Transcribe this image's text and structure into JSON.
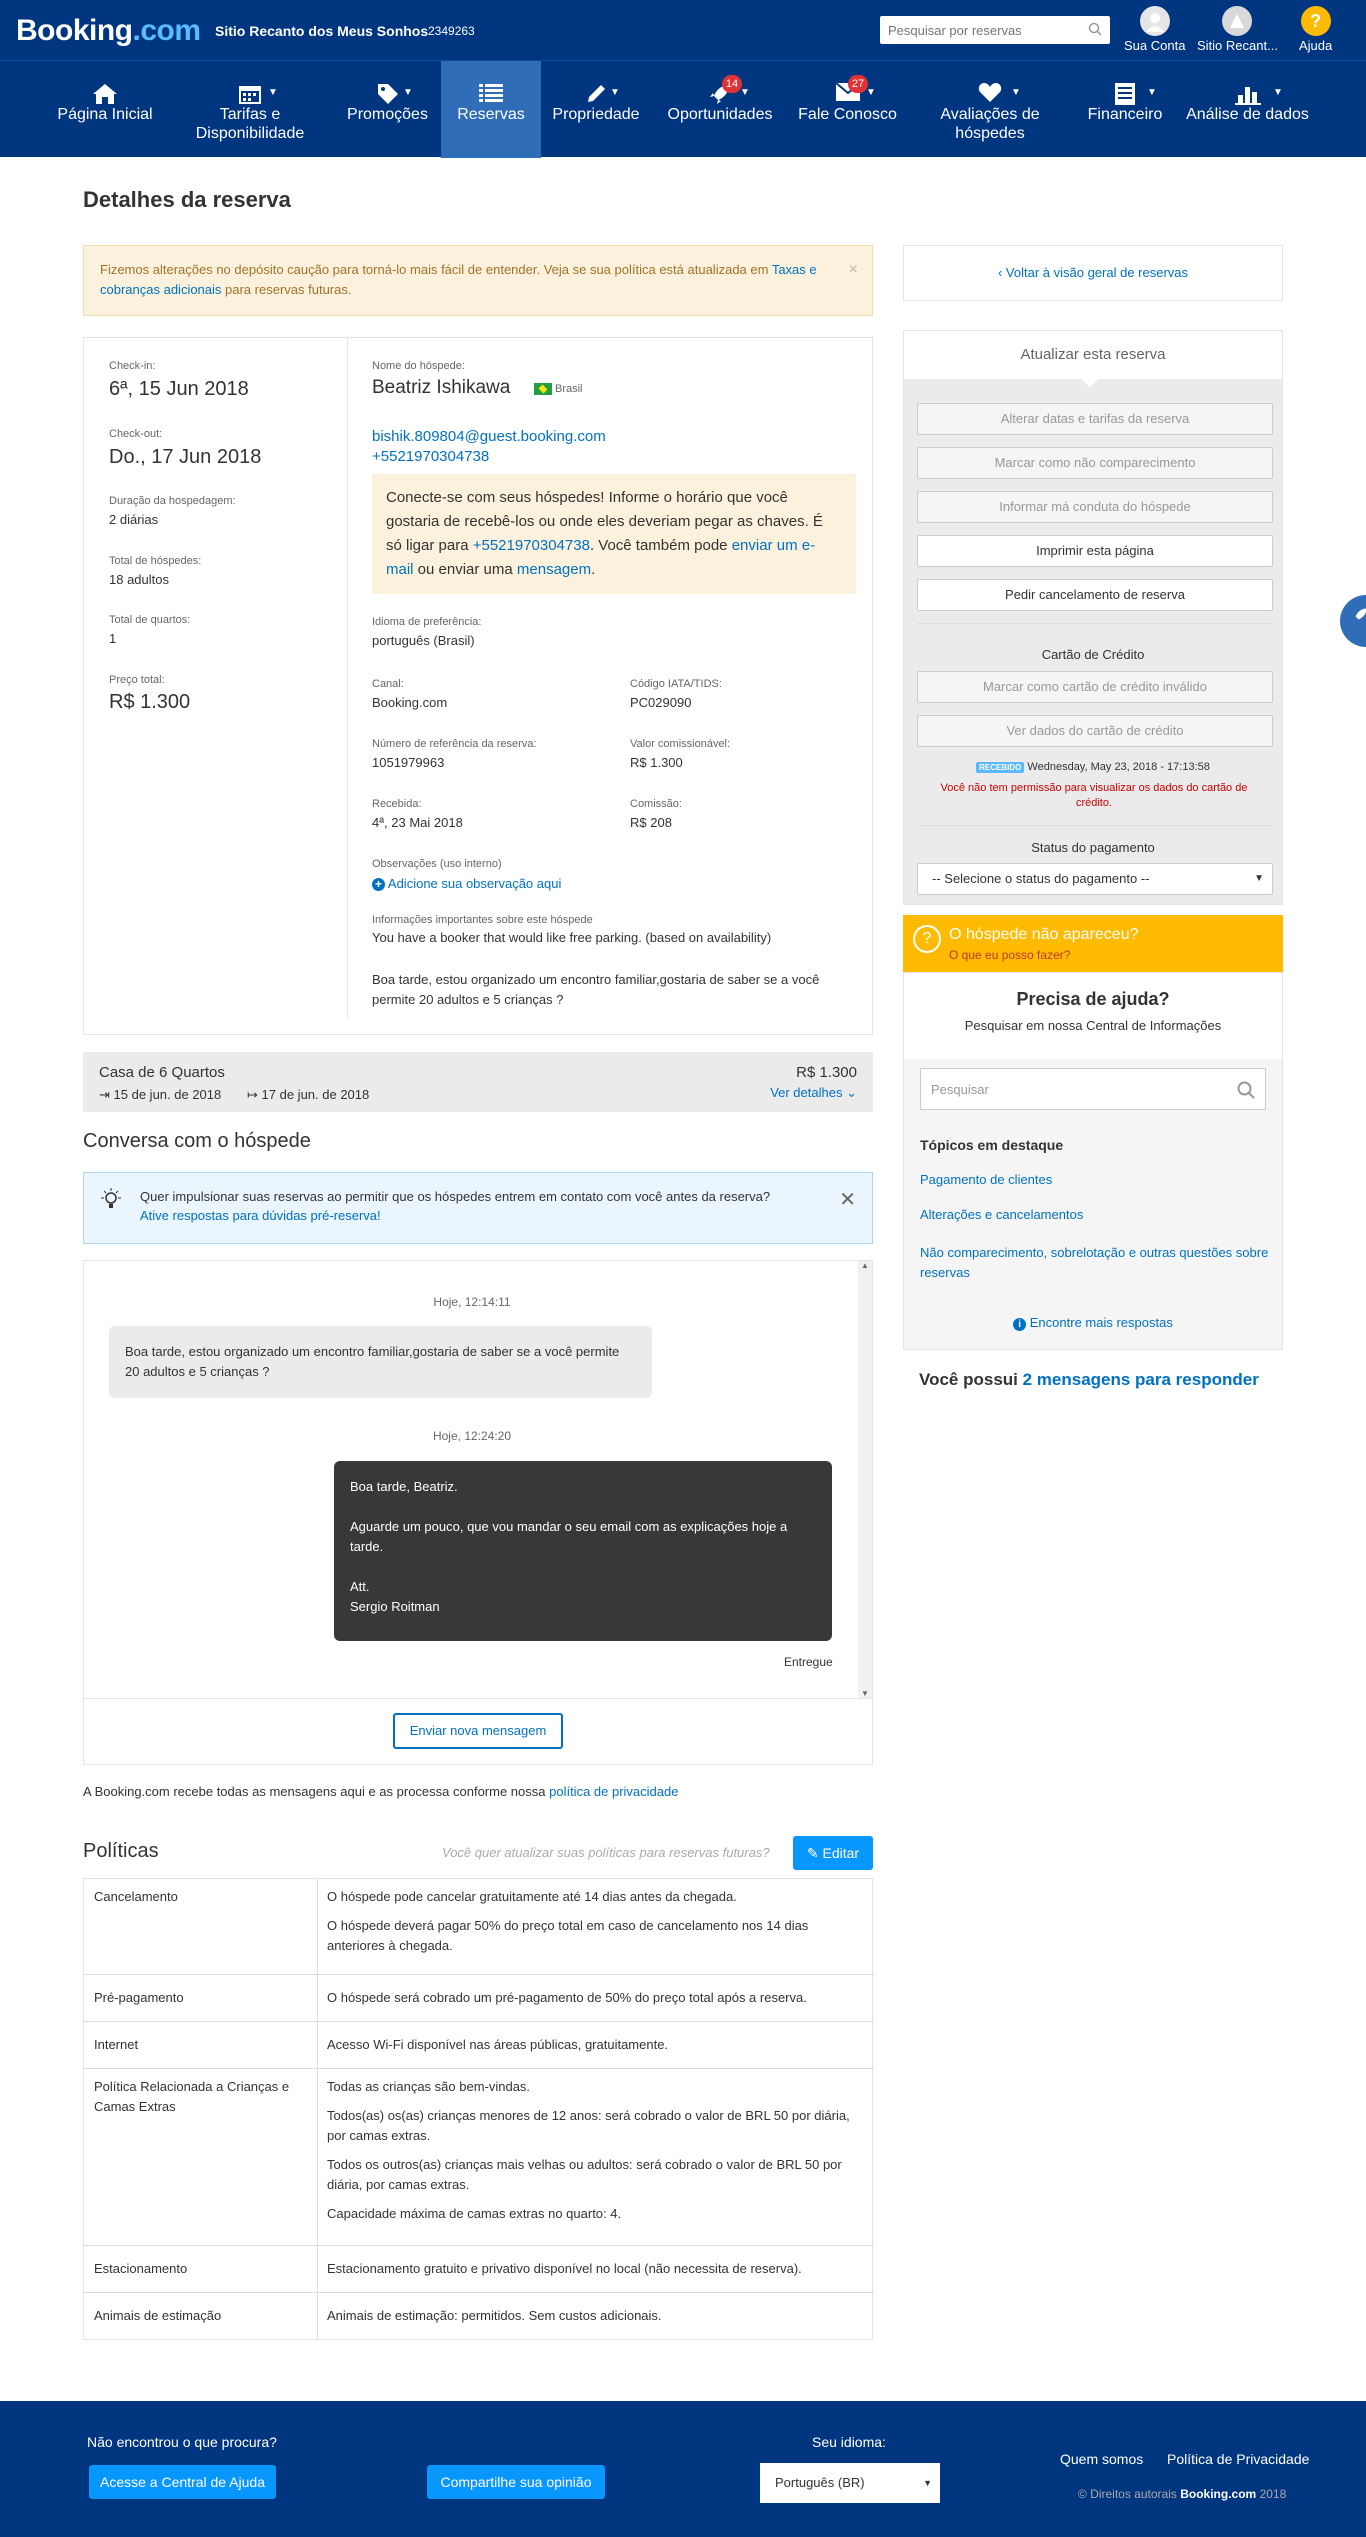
{
  "topbar": {
    "logo_a": "Booking",
    "logo_b": ".com",
    "hotel_name": "Sitio Recanto dos Meus Sonhos",
    "hotel_id": "2349263",
    "search_placeholder": "Pesquisar por reservas",
    "account_label": "Sua Conta",
    "property_label": "Sitio Recant...",
    "help_label": "Ajuda",
    "help_glyph": "?"
  },
  "nav": {
    "items": [
      {
        "label": "Página Inicial",
        "icon": "home-icon"
      },
      {
        "label": "Tarifas e",
        "label2": "Disponibilidade",
        "icon": "calendar-icon"
      },
      {
        "label": "Promoções",
        "icon": "tag-icon"
      },
      {
        "label": "Reservas",
        "icon": "list-icon"
      },
      {
        "label": "Propriedade",
        "icon": "pencil-icon"
      },
      {
        "label": "Oportunidades",
        "icon": "rocket-icon",
        "badge": "14"
      },
      {
        "label": "Fale Conosco",
        "icon": "mail-icon",
        "badge": "27"
      },
      {
        "label": "Avaliações de",
        "label2": "hóspedes",
        "icon": "heart-icon"
      },
      {
        "label": "Financeiro",
        "icon": "document-icon"
      },
      {
        "label": "Análise de dados",
        "icon": "bar-chart-icon"
      }
    ]
  },
  "page_title": "Detalhes da reserva",
  "alert": {
    "text": "Fizemos alterações no depósito caução para torná-lo mais fácil de entender. Veja se sua política está atualizada em ",
    "link": "Taxas e cobranças adicionais",
    "tail": " para reservas futuras.",
    "close": "×"
  },
  "booking": {
    "checkin_label": "Check-in:",
    "checkin": "6ª, 15 Jun 2018",
    "checkout_label": "Check-out:",
    "checkout": "Do., 17 Jun 2018",
    "duration_label": "Duração da hospedagem:",
    "duration": "2 diárias",
    "guests_label": "Total de hóspedes:",
    "guests": "18 adultos",
    "rooms_label": "Total de quartos:",
    "rooms": "1",
    "price_label": "Preço total:",
    "price": "R$ 1.300",
    "guest_name_label": "Nome do hóspede:",
    "guest_name": "Beatriz Ishikawa",
    "country": "Brasil",
    "email": "bishik.809804@guest.booking.com",
    "phone": "+5521970304738",
    "tip_a": "Conecte-se com seus hóspedes! Informe o horário que você gostaria de recebê-los ou onde eles deveriam pegar as chaves. É só ligar para ",
    "tip_phone": "+5521970304738",
    "tip_b": ". Você também pode ",
    "tip_email": "enviar um e-mail",
    "tip_c": " ou enviar uma ",
    "tip_msg": "mensagem",
    "tip_d": ".",
    "lang_label": "Idioma de preferência:",
    "lang": "português (Brasil)",
    "channel_label": "Canal:",
    "channel": "Booking.com",
    "iata_label": "Código IATA/TIDS:",
    "iata": "PC029090",
    "ref_label": "Número de referência da reserva:",
    "ref": "1051979963",
    "comm_value_label": "Valor comissionável:",
    "comm_value": "R$ 1.300",
    "received_label": "Recebida:",
    "received": "4ª, 23 Mai 2018",
    "commission_label": "Comissão:",
    "commission": "R$ 208",
    "notes_label": "Observações (uso interno)",
    "notes_add": "Adicione sua observação aqui",
    "info_label": "Informações importantes sobre este hóspede",
    "info_text": "You have a booker that would like free parking. (based on availability)",
    "guest_msg": "Boa tarde, estou organizado um encontro familiar,gostaria de saber se a você permite  20 adultos e 5 crianças ?"
  },
  "room": {
    "name": "Casa de 6 Quartos",
    "from": "15 de jun. de 2018",
    "to": "17 de jun. de 2018",
    "price": "R$ 1.300",
    "details": "Ver detalhes"
  },
  "conversation": {
    "title": "Conversa com o hóspede",
    "promo_text": "Quer impulsionar suas reservas ao permitir que os hóspedes entrem em contato com você antes da reserva?",
    "promo_link": "Ative respostas para dúvidas pré-reserva!",
    "time1": "Hoje, 12:14:11",
    "msg1": "Boa tarde, estou organizado um encontro familiar,gostaria de saber se a você permite 20 adultos e 5 crianças ?",
    "time2": "Hoje, 12:24:20",
    "msg2_l1": "Boa tarde, Beatriz.",
    "msg2_l2": "Aguarde um pouco, que vou mandar o seu email com as explicações hoje a tarde.",
    "msg2_l3": "Att.",
    "msg2_l4": "Sergio Roitman",
    "delivered": "Entregue",
    "new_msg_button": "Enviar nova mensagem",
    "privacy_a": "A Booking.com recebe todas as mensagens aqui e as processa conforme nossa ",
    "privacy_link": "política de privacidade"
  },
  "policies": {
    "title": "Políticas",
    "prompt": "Você quer atualizar suas políticas para reservas futuras?",
    "edit": "Editar",
    "rows": [
      {
        "k": "Cancelamento",
        "v": [
          "O hóspede pode cancelar gratuitamente até 14 dias antes da chegada.",
          "O hóspede deverá pagar 50% do preço total em caso de cancelamento nos 14 dias anteriores à chegada."
        ]
      },
      {
        "k": "Pré-pagamento",
        "v": [
          "O hóspede será cobrado um pré-pagamento de 50% do preço total após a reserva."
        ]
      },
      {
        "k": "Internet",
        "v": [
          "Acesso Wi-Fi disponível nas áreas públicas, gratuitamente."
        ]
      },
      {
        "k": "Política Relacionada a Crianças e Camas Extras",
        "v": [
          "Todas as crianças são bem-vindas.",
          "Todos(as) os(as) crianças menores de 12 anos: será cobrado o valor de BRL 50 por diária, por camas extras.",
          "Todos os outros(as) crianças mais velhas ou adultos: será cobrado o valor de BRL 50 por diária, por camas extras.",
          "Capacidade máxima de camas extras no quarto: 4."
        ]
      },
      {
        "k": "Estacionamento",
        "v": [
          "Estacionamento gratuito e privativo disponível no local (não necessita de reserva)."
        ]
      },
      {
        "k": "Animais de estimação",
        "v": [
          "Animais de estimação: permitidos. Sem custos adicionais."
        ]
      }
    ]
  },
  "sidebar": {
    "back": "Voltar à visão geral de reservas",
    "update_title": "Atualizar esta reserva",
    "btn_change": "Alterar datas e tarifas da reserva",
    "btn_noshow": "Marcar como não comparecimento",
    "btn_misconduct": "Informar má conduta do hóspede",
    "btn_print": "Imprimir esta página",
    "btn_cancel": "Pedir cancelamento de reserva",
    "cc_title": "Cartão de Crédito",
    "btn_cc_invalid": "Marcar como cartão de crédito inválido",
    "btn_cc_view": "Ver dados do cartão de crédito",
    "received_badge": "RECEBIDO",
    "received_date": "Wednesday, May 23, 2018 - 17:13:58",
    "cc_warning": "Você não tem permissão para visualizar os dados do cartão de crédito.",
    "payment_title": "Status do pagamento",
    "payment_select": "-- Selecione o status do pagamento --",
    "noshow_title": "O hóspede não apareceu?",
    "noshow_link": "O que eu posso fazer?",
    "help_title": "Precisa de ajuda?",
    "help_sub": "Pesquisar em nossa Central de Informações",
    "help_placeholder": "Pesquisar",
    "topics_title": "Tópicos em destaque",
    "topics": [
      "Pagamento de clientes",
      "Alterações e cancelamentos",
      "Não comparecimento, sobrelotação e outras questões sobre reservas"
    ],
    "more": "Encontre mais respostas",
    "messages_a": "Você possui ",
    "messages_link": "2 mensagens para responder"
  },
  "footer": {
    "not_found": "Não encontrou o que procura?",
    "help_center": "Acesse a Central de Ajuda",
    "share": "Compartilhe sua opinião",
    "lang_label": "Seu idioma:",
    "lang_value": "Português (BR)",
    "about": "Quem somos",
    "privacy": "Política de Privacidade",
    "copyright_a": "© Direitos autorais ",
    "copyright_brand": "Booking.com",
    "copyright_year": " 2018"
  },
  "colors": {
    "brand": "#003580",
    "active_nav": "#2f6db8",
    "link": "#0071c2",
    "badge": "#e03134",
    "warning": "#febb02",
    "cta": "#0896ff"
  }
}
